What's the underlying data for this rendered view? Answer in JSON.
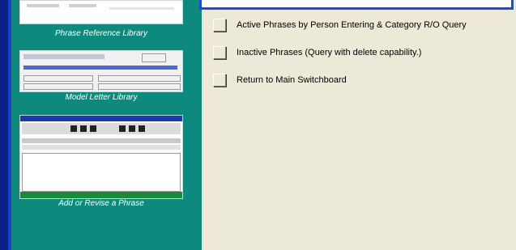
{
  "library": {
    "items": [
      {
        "label": "Phrase Reference Library"
      },
      {
        "label": "Model Letter Library"
      },
      {
        "label": "Add or Revise a Phrase"
      }
    ]
  },
  "menu": {
    "items": [
      {
        "label": "Active Phrases by Person Entering & Category R/O Query"
      },
      {
        "label": "Inactive Phrases (Query with delete capability.)"
      },
      {
        "label": "Return to Main Switchboard"
      }
    ]
  },
  "colors": {
    "teal_panel": "#0d8a7d",
    "window_border": "#2347d6",
    "panel_bg": "#ece9d8"
  }
}
